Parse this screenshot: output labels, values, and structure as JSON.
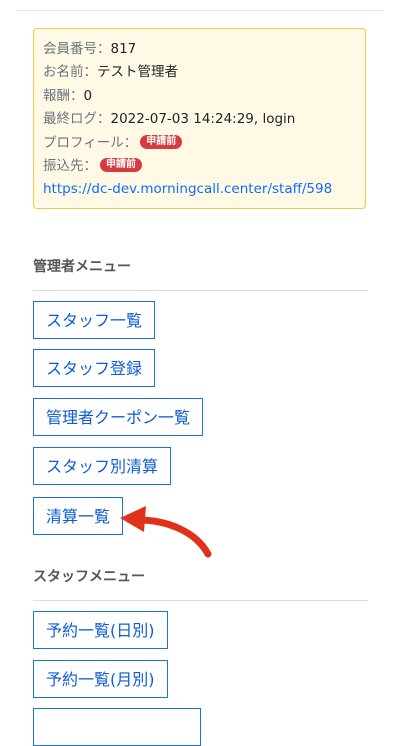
{
  "member": {
    "number_label": "会員番号：",
    "number_value": "817",
    "name_label": "お名前：",
    "name_value": "テスト管理者",
    "reward_label": "報酬：",
    "reward_value": "0",
    "last_log_label": "最終ログ：",
    "last_log_value": "2022-07-03 14:24:29, login",
    "profile_label": "プロフィール：",
    "profile_badge": "申請前",
    "transfer_label": "振込先：",
    "transfer_badge": "申請前",
    "url": "https://dc-dev.morningcall.center/staff/598"
  },
  "admin_menu": {
    "title": "管理者メニュー",
    "items": [
      {
        "label": "スタッフ一覧"
      },
      {
        "label": "スタッフ登録"
      },
      {
        "label": "管理者クーポン一覧"
      },
      {
        "label": "スタッフ別清算"
      },
      {
        "label": "清算一覧"
      }
    ]
  },
  "staff_menu": {
    "title": "スタッフメニュー",
    "items": [
      {
        "label": "予約一覧(日別)"
      },
      {
        "label": "予約一覧(月別)"
      }
    ]
  },
  "colors": {
    "card_bg": "#fff9e6",
    "card_border": "#f3c74a",
    "badge": "#d83a3f",
    "link": "#0d6efd",
    "button_border": "#1a73d9",
    "arrow": "#e0311d"
  },
  "icons": {
    "annotation": "arrow-pointer-icon"
  }
}
